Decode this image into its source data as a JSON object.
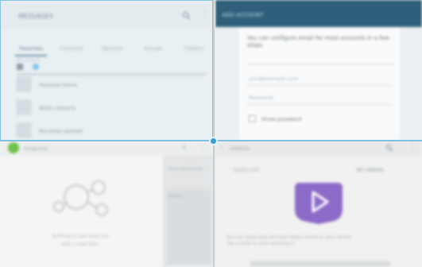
{
  "top_left": {
    "title": "MESSAGES",
    "tabs": [
      "Favorites",
      "Contacts",
      "Recents",
      "Groups",
      "Folders"
    ],
    "sub_label": "All contacts",
    "list_items": [
      "Personal items",
      "Work contacts",
      "Recently opened"
    ]
  },
  "top_right": {
    "title": "ADD ACCOUNT",
    "message": "You can configure email for most accounts in a few steps.",
    "email_placeholder": "you@example.com",
    "password_placeholder": "Password",
    "show_password_label": "Show password"
  },
  "bottom_left": {
    "title": "Snapchat",
    "sidebar_label_1": "Ideas and stories",
    "sidebar_label_2": "Recent",
    "empty_line_1": "Nothing to see here yet.",
    "empty_line_2": "Add a new item."
  },
  "bottom_right": {
    "title": "VIDEOS",
    "tab_left": "VIDEO LIST",
    "tab_right": "MY VIDEOS",
    "info_line_1": "You can easily play and edit videos saved on your device.",
    "info_line_2": "Tap a video to start watching it."
  },
  "colors": {
    "accent": "#37a1d3",
    "header_dark": "#2f5f7a",
    "video_purple": "#8c6bc8",
    "logo_green": "#6cc24a"
  }
}
